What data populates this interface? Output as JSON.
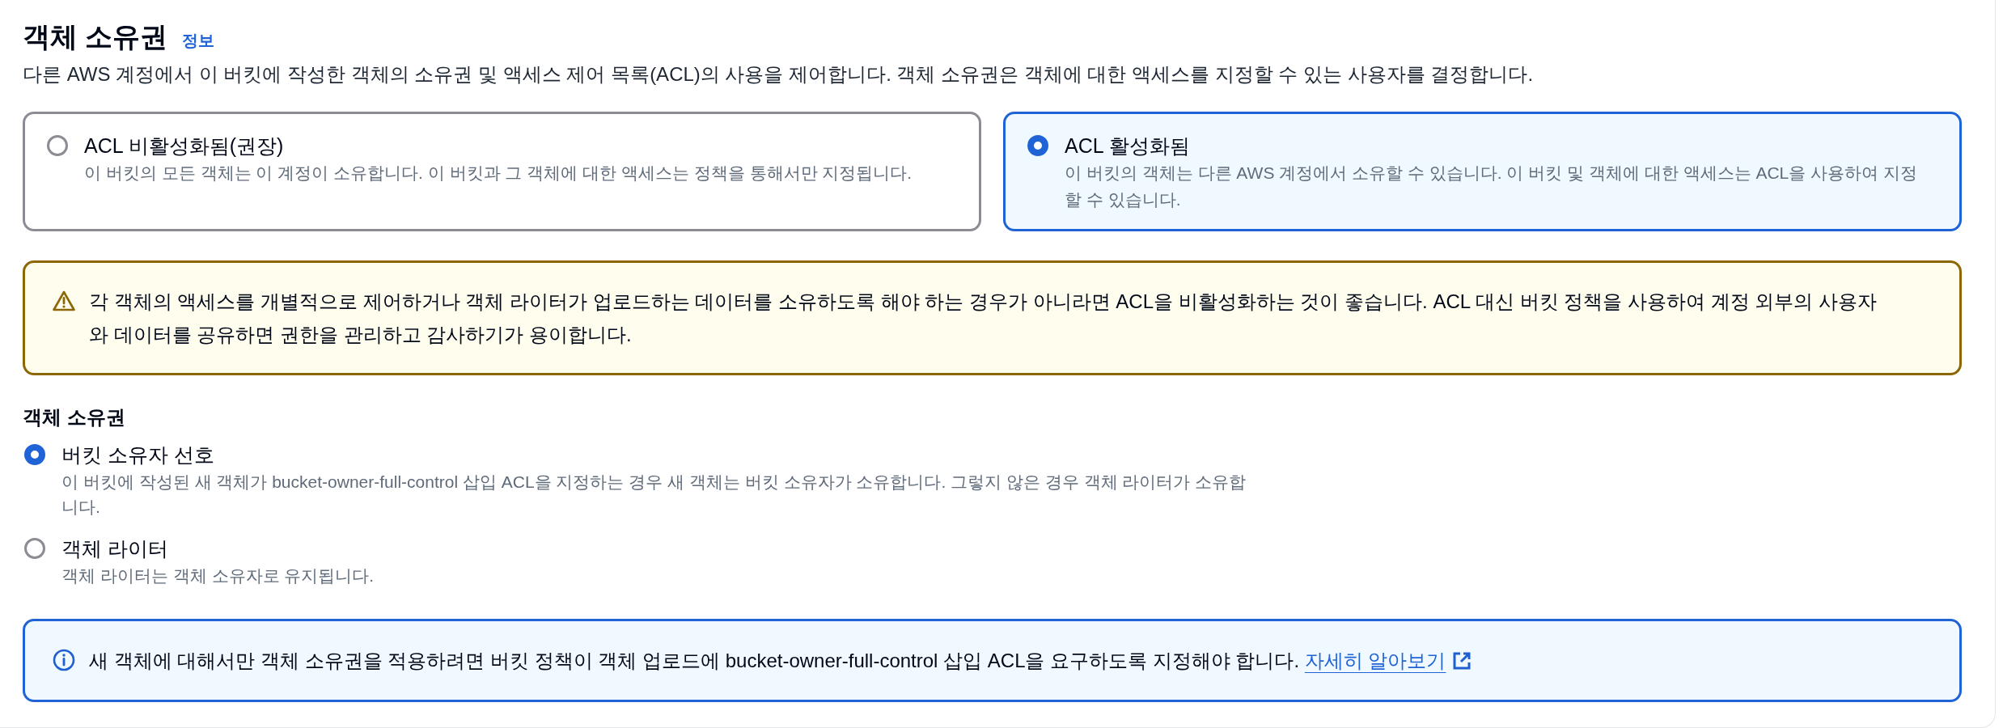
{
  "section": {
    "title": "객체 소유권",
    "info_link": "정보",
    "description": "다른 AWS 계정에서 이 버킷에 작성한 객체의 소유권 및 액세스 제어 목록(ACL)의 사용을 제어합니다. 객체 소유권은 객체에 대한 액세스를 지정할 수 있는 사용자를 결정합니다."
  },
  "acl_options": [
    {
      "label": "ACL 비활성화됨(권장)",
      "description": "이 버킷의 모든 객체는 이 계정이 소유합니다. 이 버킷과 그 객체에 대한 액세스는 정책을 통해서만 지정됩니다.",
      "selected": false
    },
    {
      "label": "ACL 활성화됨",
      "description": "이 버킷의 객체는 다른 AWS 계정에서 소유할 수 있습니다. 이 버킷 및 객체에 대한 액세스는 ACL을 사용하여 지정할 수 있습니다.",
      "selected": true
    }
  ],
  "warning_alert": {
    "kind": "warning",
    "text": "각 객체의 액세스를 개별적으로 제어하거나 객체 라이터가 업로드하는 데이터를 소유하도록 해야 하는 경우가 아니라면 ACL을 비활성화하는 것이 좋습니다. ACL 대신 버킷 정책을 사용하여 계정 외부의 사용자와 데이터를 공유하면 권한을 관리하고 감사하기가 용이합니다."
  },
  "object_ownership": {
    "label": "객체 소유권",
    "options": [
      {
        "label": "버킷 소유자 선호",
        "description": "이 버킷에 작성된 새 객체가 bucket-owner-full-control 삽입 ACL을 지정하는 경우 새 객체는 버킷 소유자가 소유합니다. 그렇지 않은 경우 객체 라이터가 소유합니다.",
        "selected": true
      },
      {
        "label": "객체 라이터",
        "description": "객체 라이터는 객체 소유자로 유지됩니다.",
        "selected": false
      }
    ]
  },
  "info_alert": {
    "kind": "info",
    "text": "새 객체에 대해서만 객체 소유권을 적용하려면 버킷 정책이 객체 업로드에 bucket-owner-full-control 삽입 ACL을 요구하도록 지정해야 합니다.",
    "link": "자세히 알아보기"
  }
}
